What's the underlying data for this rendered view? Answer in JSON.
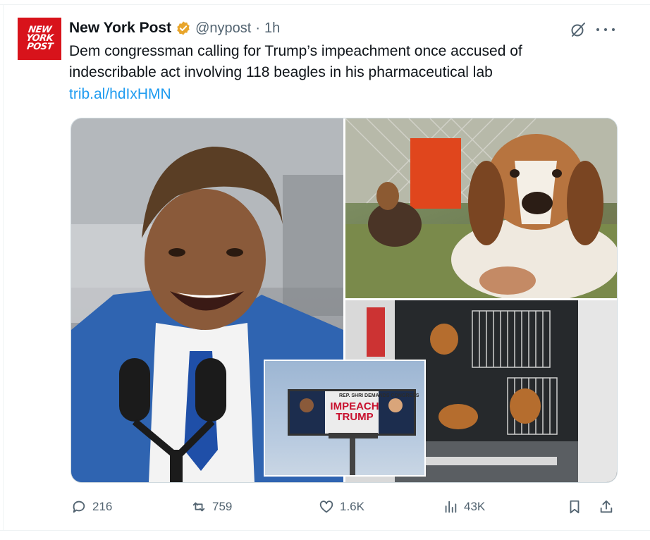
{
  "account": {
    "display_name": "New York Post",
    "handle": "@nypost",
    "separator": "·",
    "time": "1h",
    "avatar_lines": [
      "NEW",
      "YORK",
      "POST"
    ],
    "verified_color": "#e8a52b"
  },
  "tweet": {
    "text_lines": [
      "Dem congressman calling for Trump’s impeachment once accused of",
      "indescribable act involving 118 beagles in his pharmaceutical lab"
    ],
    "link": "trib.al/hdIxHMN"
  },
  "media": {
    "billboard_title": "REP. SHRI DEMANDS CONGRESS",
    "billboard_main": "IMPEACH TRUMP"
  },
  "actions": {
    "replies": "216",
    "reposts": "759",
    "likes": "1.6K",
    "views": "43K"
  },
  "colors": {
    "link": "#1d9bf0",
    "secondary_text": "#536471",
    "brand_red": "#d8131b"
  }
}
